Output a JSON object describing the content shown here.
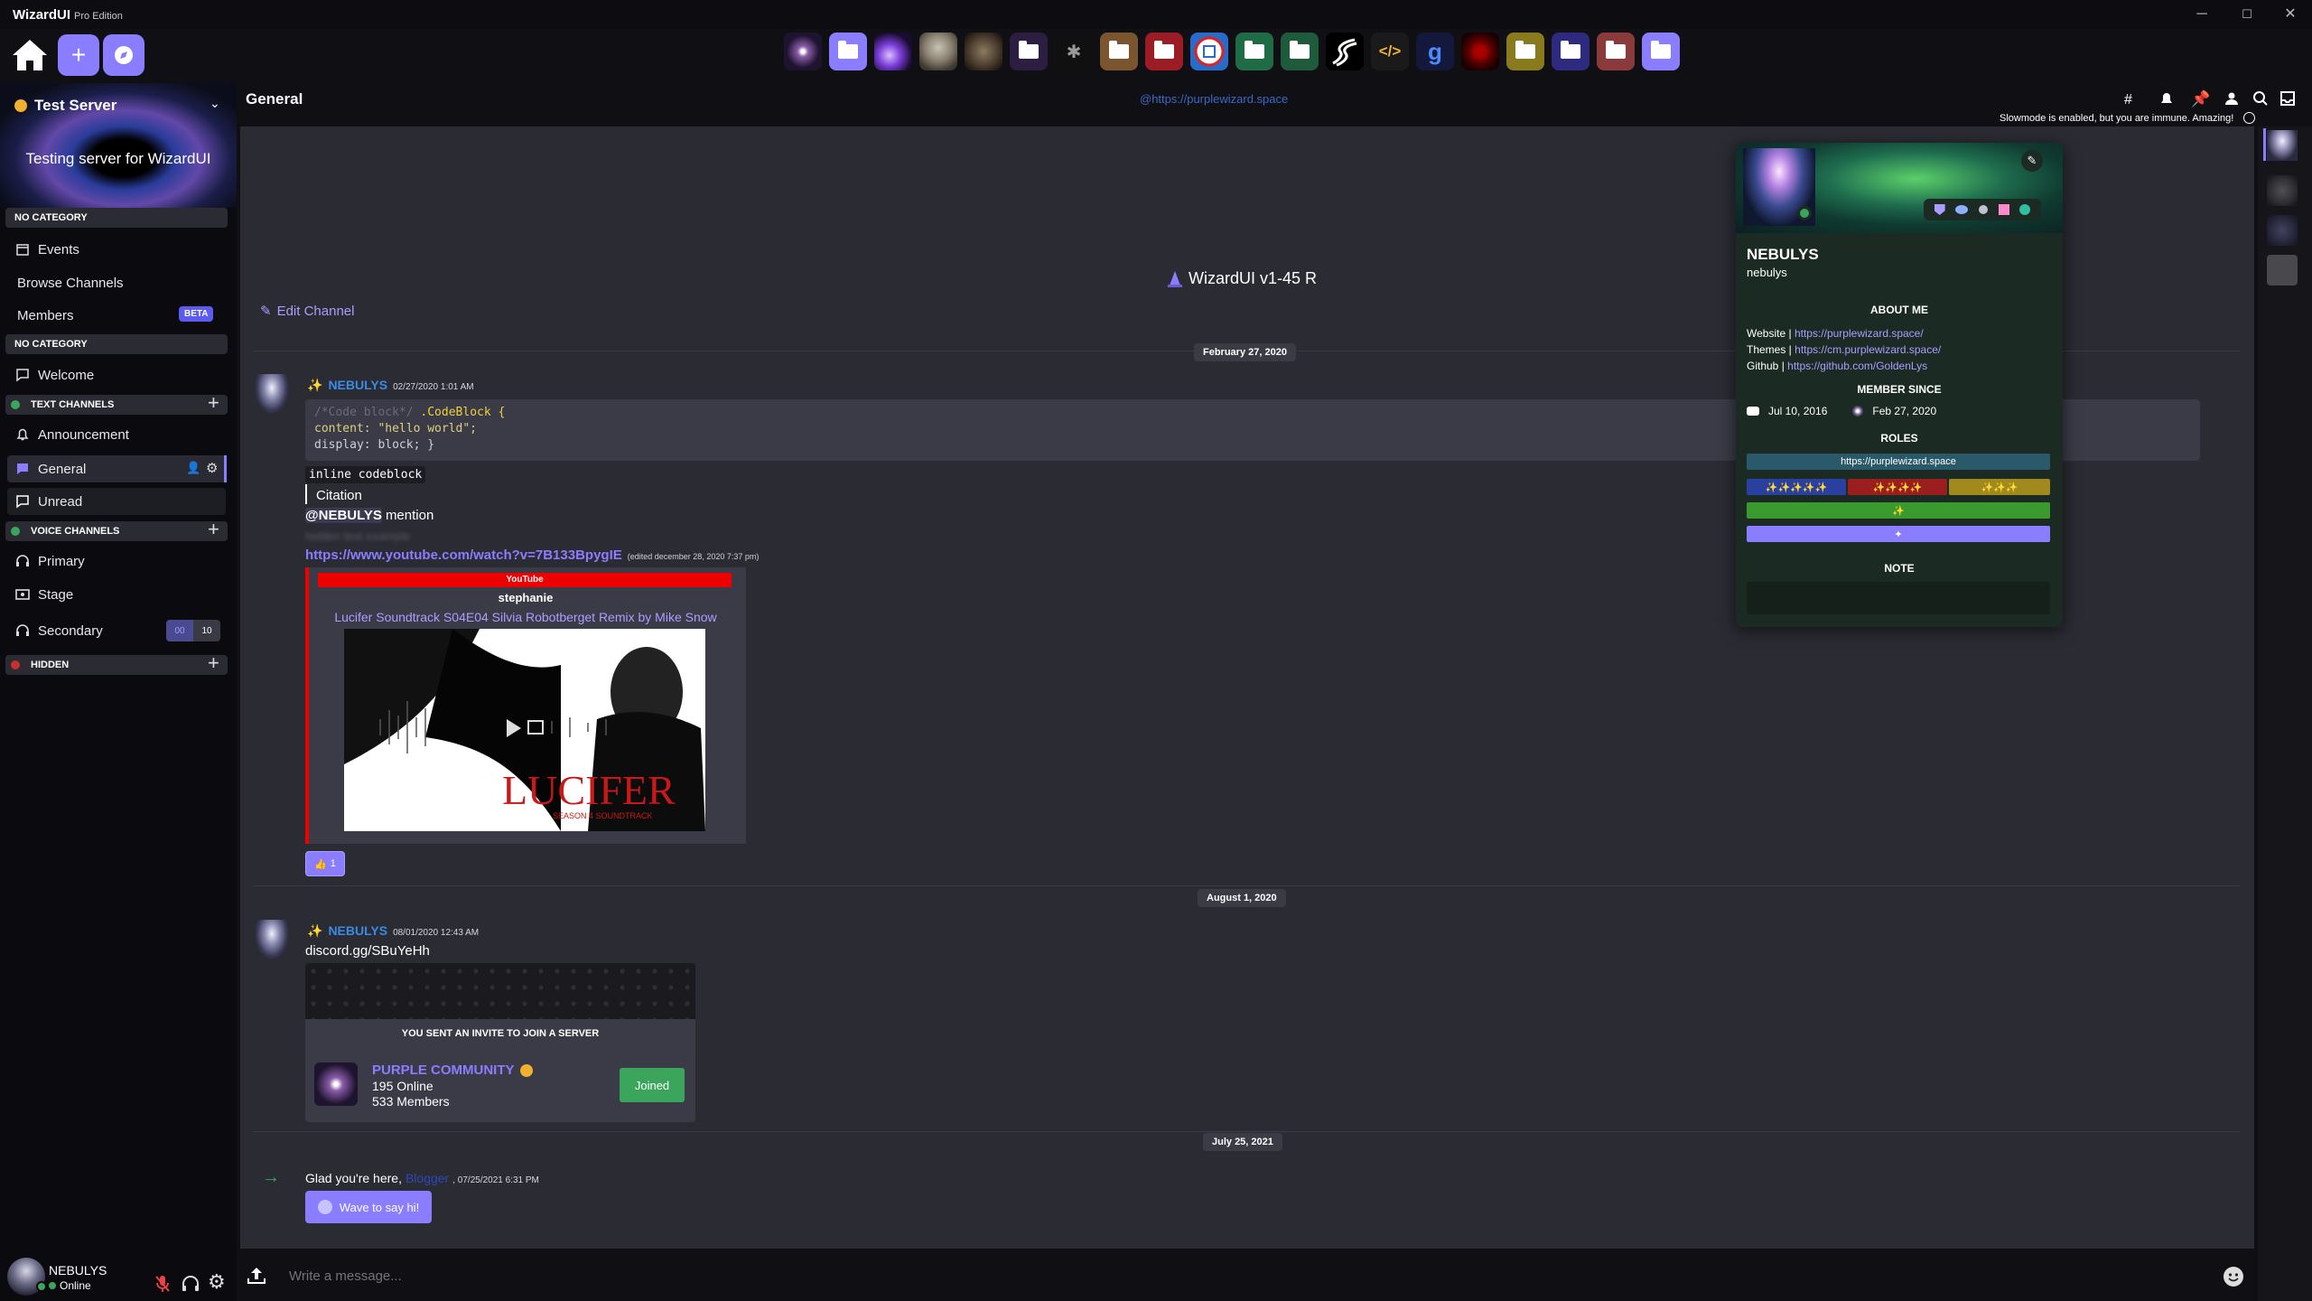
{
  "titlebar": {
    "app": "WizardUI",
    "edition": "Pro Edition",
    "min": "─",
    "max": "☐",
    "close": "✕"
  },
  "server": {
    "name": "Test Server",
    "description": "Testing server for WizardUI"
  },
  "sidebar": {
    "cat_no_category_1": "NO CATEGORY",
    "events": "Events",
    "browse": "Browse Channels",
    "members": "Members",
    "beta": "BETA",
    "cat_no_category_2": "NO CATEGORY",
    "welcome": "Welcome",
    "cat_text": "TEXT CHANNELS",
    "announcement": "Announcement",
    "general": "General",
    "unread": "Unread",
    "cat_voice": "VOICE CHANNELS",
    "primary": "Primary",
    "stage": "Stage",
    "secondary": "Secondary",
    "secondary_count": "00",
    "secondary_limit": "10",
    "cat_hidden": "HIDDEN"
  },
  "user": {
    "name": "NEBULYS",
    "status": "Online"
  },
  "header": {
    "channel": "General",
    "topic": "@https://purplewizard.space",
    "slowmode": "Slowmode is enabled, but you are immune. Amazing!"
  },
  "channel_intro": {
    "title": "WizardUI v1-45 R",
    "edit": "Edit Channel"
  },
  "dates": {
    "d1": "February 27, 2020",
    "d2": "August 1, 2020",
    "d3": "July 25, 2021"
  },
  "msg1": {
    "author": "NEBULYS",
    "time": "02/27/2020 1:01 AM",
    "code_line1a": "/*Code block*/",
    "code_line1b": ".CodeBlock {",
    "code_line2": "content: \"hello world\";",
    "code_line3": "display: block; }",
    "inline": "inline codeblock",
    "citation": "Citation",
    "mention": "@NEBULYS",
    "mention_rest": "mention",
    "spoiler": "hidden text example",
    "link": "https://www.youtube.com/watch?v=7B133BpygIE",
    "edited": "(edited december 28, 2020 7:37 pm)",
    "embed_provider": "YouTube",
    "embed_author": "stephanie",
    "embed_title": "Lucifer Soundtrack S04E04 Silvia Robotberget Remix by Mike Snow",
    "poster_title": "LUCIFER",
    "poster_sub": "SEASON 4 SOUNDTRACK",
    "reaction_count": "1"
  },
  "msg2": {
    "author": "NEBULYS",
    "time": "08/01/2020 12:43 AM",
    "text": "discord.gg/SBuYeHh",
    "invite_header": "YOU SENT AN INVITE TO JOIN A SERVER",
    "guild": "PURPLE COMMUNITY",
    "online": "195 Online",
    "members": "533 Members",
    "joined": "Joined"
  },
  "msg3": {
    "text": "Glad you're here,",
    "user": "Blogger",
    "time": ", 07/25/2021 6:31 PM",
    "wave": "Wave to say hi!"
  },
  "composer": {
    "placeholder": "Write a message..."
  },
  "profile": {
    "name": "NEBULYS",
    "username": "nebulys",
    "about_h": "ABOUT ME",
    "website_l": "Website |",
    "website": "https://purplewizard.space/",
    "themes_l": "Themes |",
    "themes": "https://cm.purplewizard.space/",
    "github_l": "Github  |",
    "github": "https://github.com/GoldenLys",
    "since_h": "MEMBER SINCE",
    "since_discord": "Jul 10, 2016",
    "since_server": "Feb 27, 2020",
    "roles_h": "ROLES",
    "role1": "https://purplewizard.space",
    "role2": "✨✨✨✨✨",
    "role3": "✨✨✨✨",
    "role4": "✨✨✨",
    "role5": "✨",
    "role6": "✦",
    "note_h": "NOTE"
  },
  "colors": {
    "accent": "#8a7dff",
    "link": "#4da3ff",
    "green": "#3ba55c"
  }
}
